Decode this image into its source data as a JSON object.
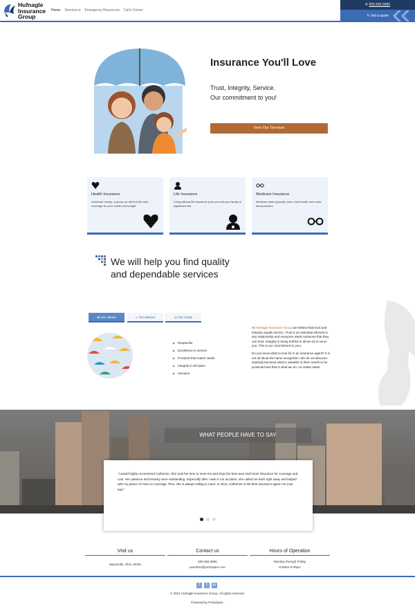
{
  "brand": {
    "line1": "Hufnagle",
    "line2": "Insurance",
    "line3": "Group"
  },
  "nav": {
    "items": [
      "Home",
      "Services ▾",
      "Emergency Resources",
      "Cat's Corner"
    ]
  },
  "topbar": {
    "phone": "555.555.5555",
    "quote": "Get a quote"
  },
  "hero": {
    "title": "Insurance You'll Love",
    "line1": "Trust, Integrity, Service.",
    "line2": "Our commitment to you!",
    "button": "View Our Services"
  },
  "cards": [
    {
      "title": "Health Insurance",
      "text": "Individual, family, or group we will find the best coverage for your needs and budget.",
      "icon": "heart-icon"
    },
    {
      "title": "Life Insurance",
      "text": "Living without life insurance puts you and your family at significant risk.",
      "icon": "doctor-icon"
    },
    {
      "title": "Medicare Insurance",
      "text": "Medicare plans typically cover most health care costs facing seniors.",
      "icon": "glasses-icon"
    }
  ],
  "help": {
    "title": "We will help you find quality and dependable services"
  },
  "tabs": [
    "Our Values",
    "Our Mission",
    "Our Goals"
  ],
  "values": [
    "Respectful",
    "Excellence in service",
    "Products that match needs",
    "Integrity in all cases",
    "Genuine"
  ],
  "about": {
    "prefix": "At ",
    "brand": "Hufnagle Insurance Group",
    "p1": " we believe that trust and integrity equals service. Trust is an essential element in any relationship and everyone wants someone that they can trust. Integrity is being truthful in all we do to serve you. This is our commitment to you!",
    "p2": "Do you know what to look for in an insurance agent? It is not all about the name recognition. We do not discount anybody because what is valuable in them needs to be protected and that is what we do, no matter what!"
  },
  "testimonials": {
    "heading": "WHAT PEOPLE HAVE TO SAY",
    "quote": "\"I would highly recommend Catherine. She took her time to meet me and shop the best auto and home insurance for coverage and cost. Her patience and tenacity were outstanding. Especially after I was in car accident, she called me back right away and helped with my peace of mind on coverage. Plus, she is always willing to meet. In short, Catherine is the best insurance agent I've ever had.\""
  },
  "footer": {
    "visit_title": "Visit us",
    "visit_line": "Marysville, Ohio 43040",
    "contact_title": "Contact us",
    "contact_phone": "555.555.5555",
    "contact_email": "psorders@portospire.com",
    "hours_title": "Hours of Operation",
    "hours_days": "Monday through Friday",
    "hours_time": "9:00am-5:00pm",
    "copyright": "© 2022 Hufnagle Insurance Group. All rights reserved.",
    "powered": "Powered by PortoSpire."
  },
  "colors": {
    "accent": "#3b6cb3",
    "button": "#b06a35",
    "dark_tab": "#1f3a63"
  }
}
